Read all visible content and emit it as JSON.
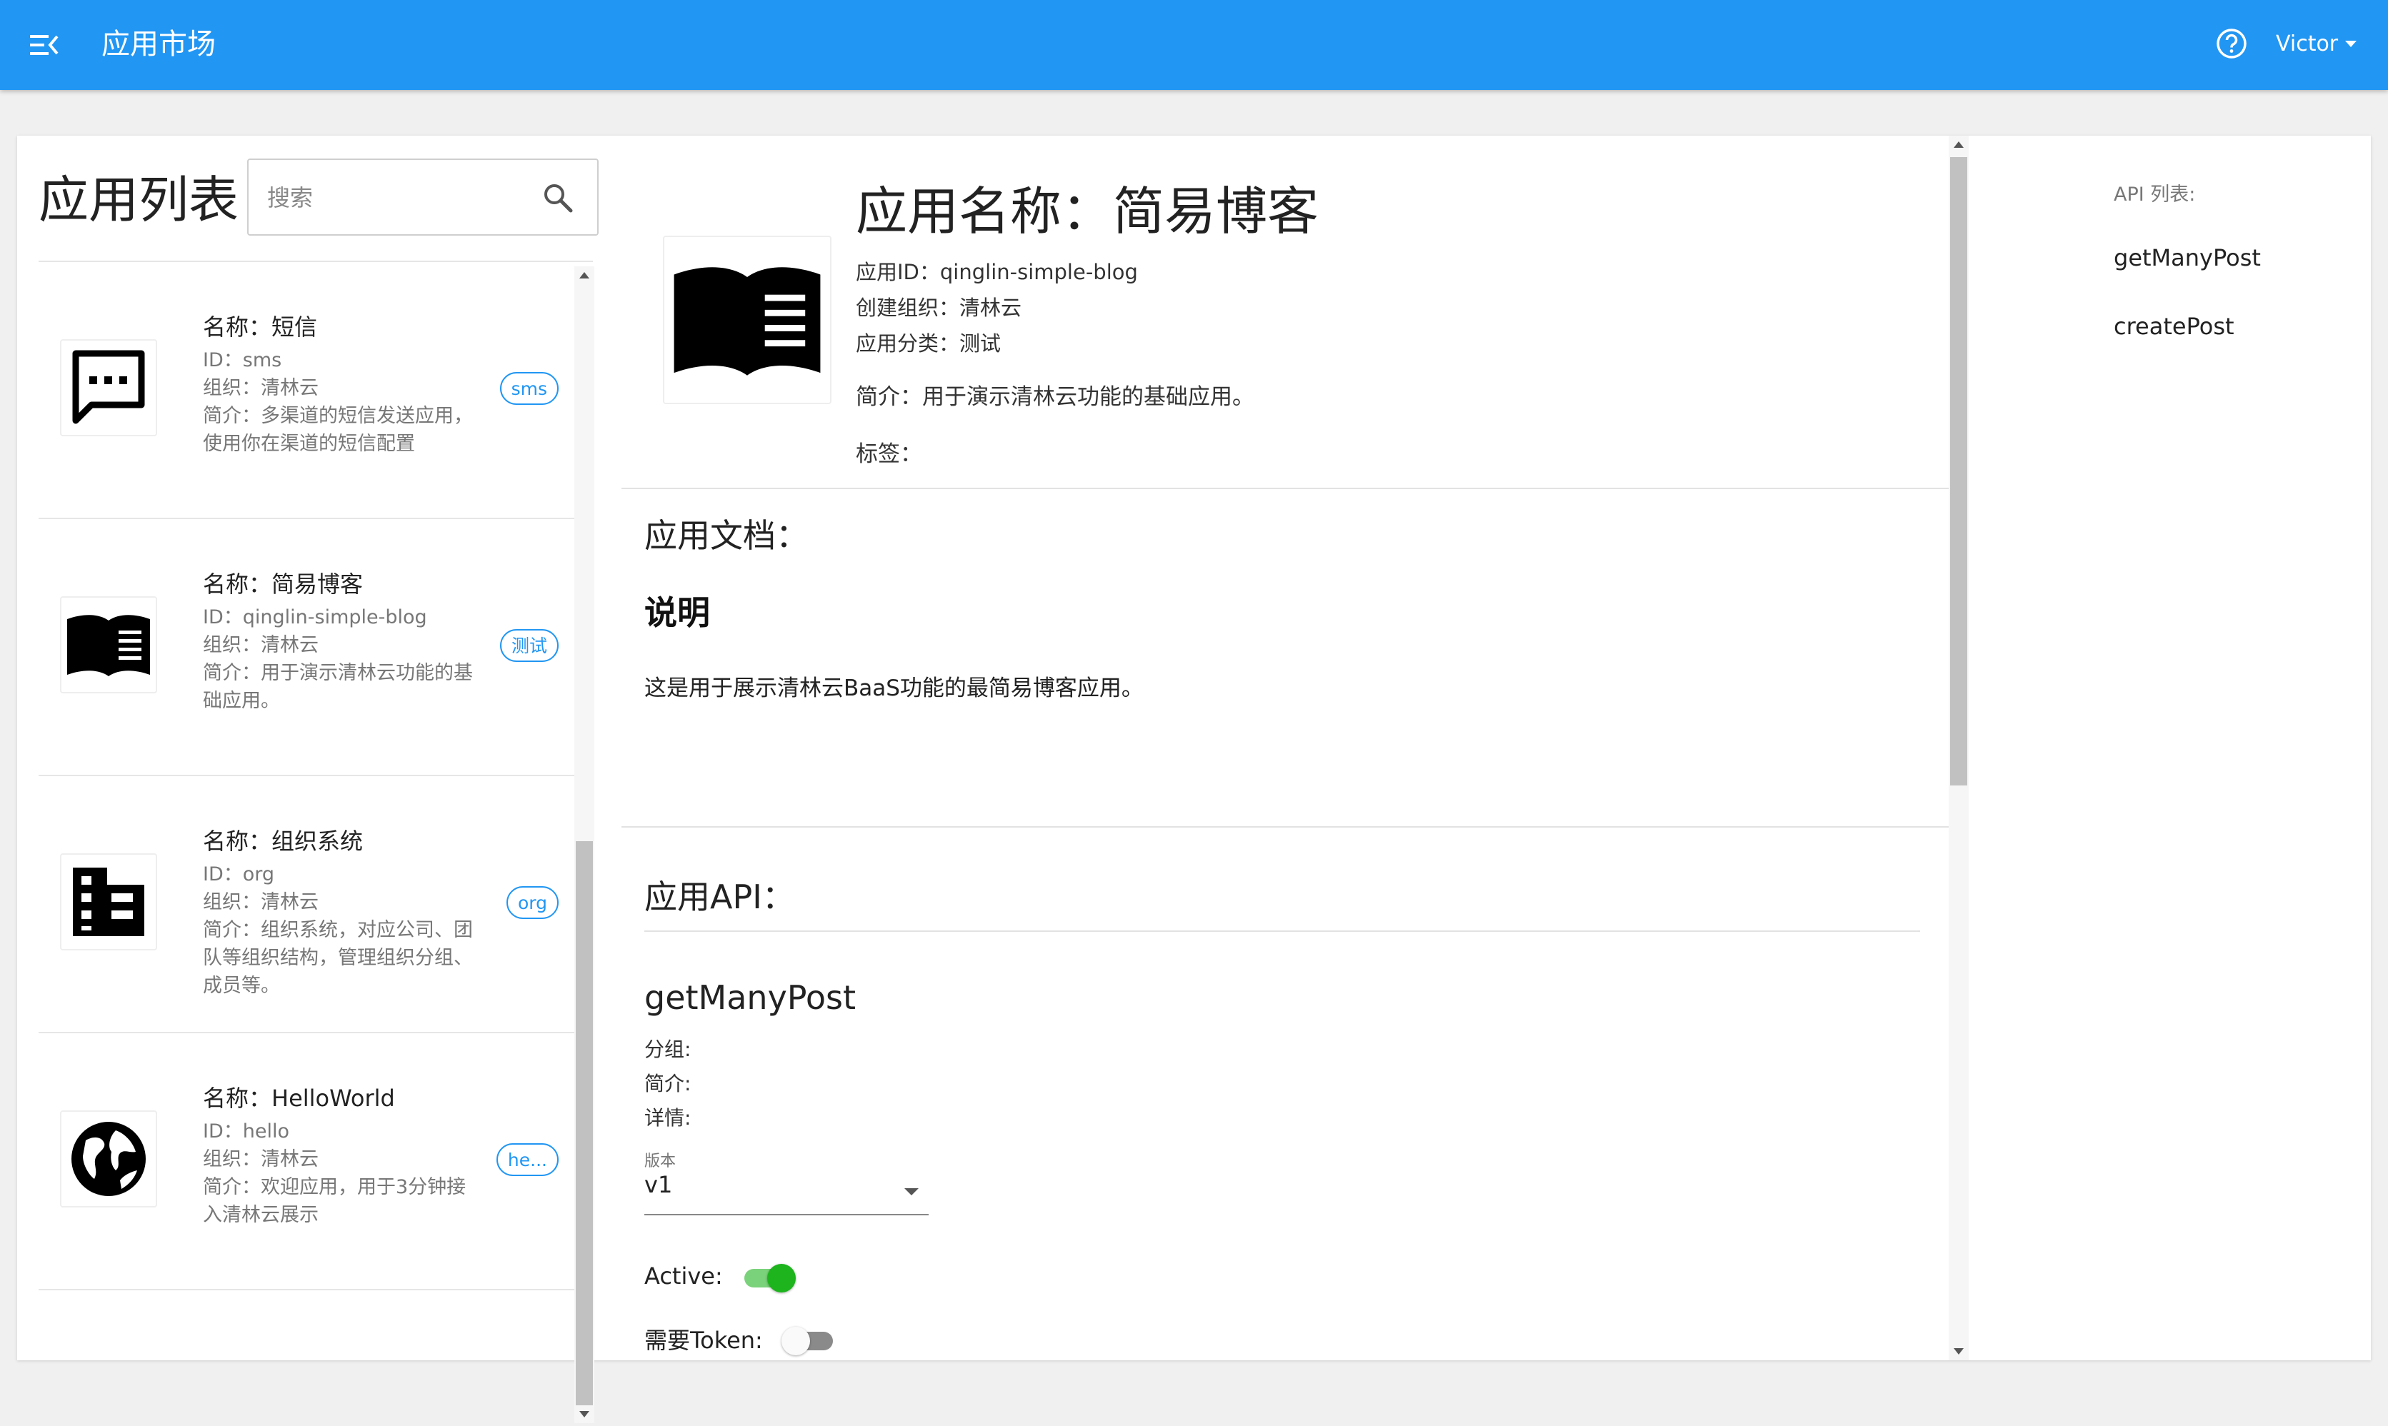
{
  "header": {
    "title": "应用市场",
    "user_name": "Victor",
    "brand_color": "#2196f3",
    "icons": [
      "menu-open-icon",
      "help-circle-icon",
      "caret-down-icon"
    ]
  },
  "sidebar": {
    "heading": "应用列表",
    "search_placeholder": "搜索",
    "apps": [
      {
        "icon": "message-dots-icon",
        "name": "名称：短信",
        "id": "ID：sms",
        "org": "组织：清林云",
        "desc": "简介：多渠道的短信发送应用，使用你在渠道的短信配置",
        "tag": "sms"
      },
      {
        "icon": "book-open-icon",
        "name": "名称：简易博客",
        "id": "ID：qinglin-simple-blog",
        "org": "组织：清林云",
        "desc": "简介：用于演示清林云功能的基础应用。",
        "tag": "测试"
      },
      {
        "icon": "domain-icon",
        "name": "名称：组织系统",
        "id": "ID：org",
        "org": "组织：清林云",
        "desc": "简介：组织系统，对应公司、团队等组织结构，管理组织分组、成员等。",
        "tag": "org"
      },
      {
        "icon": "earth-icon",
        "name": "名称：HelloWorld",
        "id": "ID：hello",
        "org": "组织：清林云",
        "desc": "简介：欢迎应用，用于3分钟接入清林云展示",
        "tag": "he..."
      }
    ]
  },
  "detail": {
    "title": "应用名称：简易博客",
    "app_id": "应用ID：qinglin-simple-blog",
    "creator_org": "创建组织：清林云",
    "category": "应用分类：测试",
    "summary": "简介：用于演示清林云功能的基础应用。",
    "tags_label": "标签：",
    "doc_section_title": "应用文档：",
    "doc_heading": "说明",
    "doc_text": "这是用于展示清林云BaaS功能的最简易博客应用。",
    "api_section_title": "应用API：",
    "api": {
      "name": "getManyPost",
      "group_label": "分组:",
      "brief_label": "简介:",
      "detail_label": "详情:",
      "version_label": "版本",
      "version_value": "v1",
      "active_label": "Active:",
      "active": true,
      "token_label": "需要Token:",
      "token_required": false
    }
  },
  "api_nav": {
    "title": "API 列表:",
    "items": [
      "getManyPost",
      "createPost"
    ]
  }
}
